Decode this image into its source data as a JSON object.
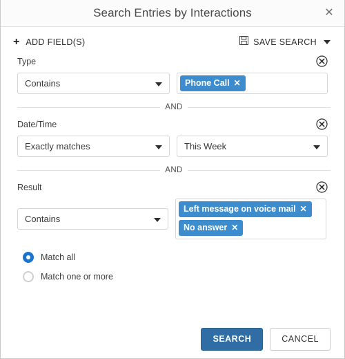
{
  "dialog": {
    "title": "Search Entries by Interactions",
    "close_icon": "close-icon"
  },
  "toolbar": {
    "add_fields_label": "ADD FIELD(S)",
    "add_icon": "plus-icon",
    "save_search_label": "SAVE SEARCH",
    "save_icon": "floppy-disk-icon",
    "caret_icon": "chevron-down-icon"
  },
  "separator": {
    "and_label": "AND"
  },
  "fields": [
    {
      "label": "Type",
      "operator": "Contains",
      "value_type": "chips",
      "chips": [
        "Phone Call"
      ],
      "remove_icon": "circle-close-icon"
    },
    {
      "label": "Date/Time",
      "operator": "Exactly matches",
      "value_type": "select",
      "value": "This Week",
      "remove_icon": "circle-close-icon"
    },
    {
      "label": "Result",
      "operator": "Contains",
      "value_type": "chips",
      "chips": [
        "Left message on voice mail",
        "No answer"
      ],
      "remove_icon": "circle-close-icon"
    }
  ],
  "match_mode": {
    "options": [
      {
        "label": "Match all",
        "selected": true
      },
      {
        "label": "Match one or more",
        "selected": false
      }
    ]
  },
  "footer": {
    "search_label": "SEARCH",
    "cancel_label": "CANCEL"
  },
  "colors": {
    "accent_button": "#2f6da4",
    "chip": "#3d8dce",
    "radio_selected": "#1b74cd"
  }
}
